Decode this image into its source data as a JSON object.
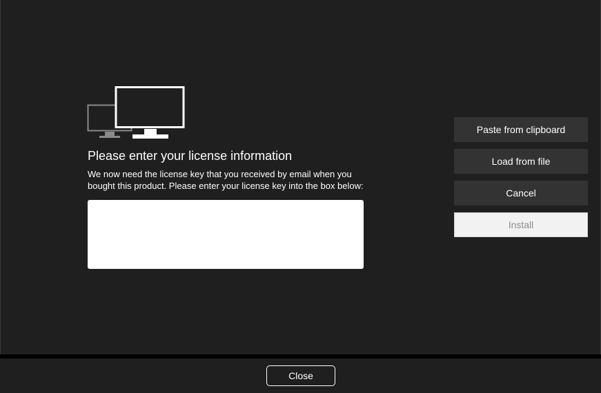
{
  "dialog": {
    "title": "Please enter your license information",
    "description": "We now need the license key that you received by email when you bought this product. Please enter your license key into the box below:",
    "license_value": "",
    "illustration_icon": "monitors-icon"
  },
  "actions": {
    "paste_label": "Paste from clipboard",
    "load_label": "Load from file",
    "cancel_label": "Cancel",
    "install_label": "Install"
  },
  "footer": {
    "close_label": "Close"
  },
  "colors": {
    "background": "#1f1f1f",
    "button": "#333333",
    "install_disabled_bg": "#f2f2f2",
    "install_disabled_text": "#8c8c8c"
  }
}
